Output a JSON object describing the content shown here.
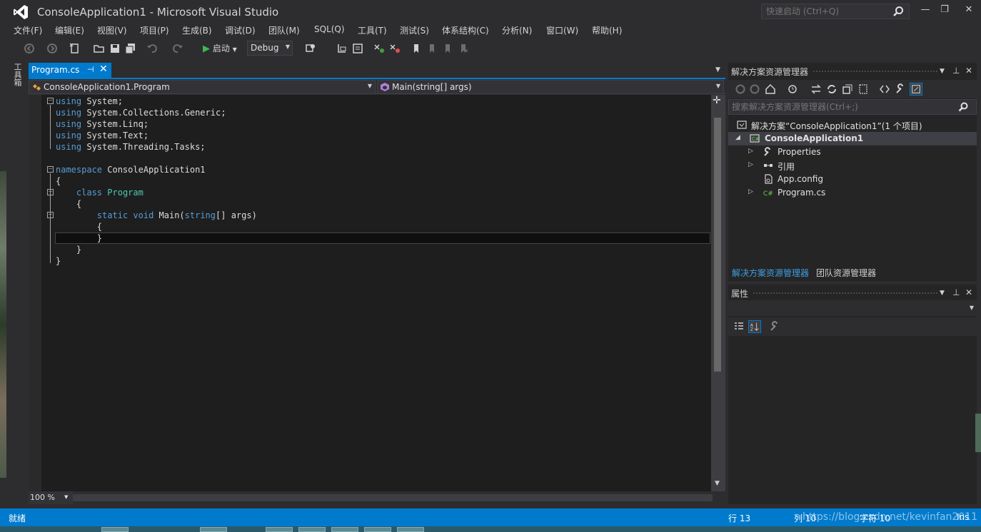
{
  "window": {
    "title": "ConsoleApplication1 - Microsoft Visual Studio",
    "quick_launch_placeholder": "快速启动 (Ctrl+Q)",
    "minimize": "—",
    "restore": "❐",
    "close": "✕"
  },
  "menu": [
    "文件(F)",
    "编辑(E)",
    "视图(V)",
    "项目(P)",
    "生成(B)",
    "调试(D)",
    "团队(M)",
    "SQL(Q)",
    "工具(T)",
    "测试(S)",
    "体系结构(C)",
    "分析(N)",
    "窗口(W)",
    "帮助(H)"
  ],
  "toolbar": {
    "start_label": "启动",
    "configuration": "Debug"
  },
  "toolbox_tab": "工具箱",
  "editor": {
    "tab_label": "Program.cs",
    "tab_pin": "⊣",
    "tab_close": "✕",
    "nav_class": "ConsoleApplication1.Program",
    "nav_member": "Main(string[] args)",
    "zoom": "100 %",
    "code": [
      [
        {
          "k": "kw",
          "t": "using"
        },
        {
          "t": " System;"
        }
      ],
      [
        {
          "k": "kw",
          "t": "using"
        },
        {
          "t": " System.Collections.Generic;"
        }
      ],
      [
        {
          "k": "kw",
          "t": "using"
        },
        {
          "t": " System.Linq;"
        }
      ],
      [
        {
          "k": "kw",
          "t": "using"
        },
        {
          "t": " System.Text;"
        }
      ],
      [
        {
          "k": "kw",
          "t": "using"
        },
        {
          "t": " System.Threading.Tasks;"
        }
      ],
      [
        {
          "t": ""
        }
      ],
      [
        {
          "k": "kw",
          "t": "namespace"
        },
        {
          "t": " ConsoleApplication1"
        }
      ],
      [
        {
          "t": "{"
        }
      ],
      [
        {
          "t": "    "
        },
        {
          "k": "kw",
          "t": "class"
        },
        {
          "t": " "
        },
        {
          "k": "ty",
          "t": "Program"
        }
      ],
      [
        {
          "t": "    {"
        }
      ],
      [
        {
          "t": "        "
        },
        {
          "k": "kw",
          "t": "static"
        },
        {
          "t": " "
        },
        {
          "k": "kw",
          "t": "void"
        },
        {
          "t": " Main("
        },
        {
          "k": "kw",
          "t": "string"
        },
        {
          "t": "[] args)"
        }
      ],
      [
        {
          "t": "        {"
        }
      ],
      [
        {
          "t": "        }"
        }
      ],
      [
        {
          "t": "    }"
        }
      ],
      [
        {
          "t": "}"
        }
      ]
    ]
  },
  "solution_explorer": {
    "title": "解决方案资源管理器",
    "search_placeholder": "搜索解决方案资源管理器(Ctrl+;)",
    "tree": [
      {
        "label": "解决方案“ConsoleApplication1”(1 个项目)",
        "icon": "solution-icon",
        "arrow": ""
      },
      {
        "label": "ConsoleApplication1",
        "icon": "csharp-project-icon",
        "arrow": "◢"
      },
      {
        "label": "Properties",
        "icon": "wrench-icon",
        "arrow": "▷"
      },
      {
        "label": "引用",
        "icon": "references-icon",
        "arrow": "▷"
      },
      {
        "label": "App.config",
        "icon": "config-file-icon",
        "arrow": ""
      },
      {
        "label": "Program.cs",
        "icon": "csharp-file-icon",
        "arrow": "▷"
      }
    ],
    "tabs": [
      "解决方案资源管理器",
      "团队资源管理器"
    ]
  },
  "properties": {
    "title": "属性"
  },
  "statusbar": {
    "text": "就绪",
    "line": "行 13",
    "col": "列 10",
    "char": "字符 10",
    "ins": "Ins"
  },
  "watermark": "https://blog.csdn.net/kevinfan2011",
  "colors": {
    "accent": "#007acc",
    "keyword": "#569cd6",
    "type": "#4ec9b0",
    "editor_bg": "#1e1e1e"
  }
}
